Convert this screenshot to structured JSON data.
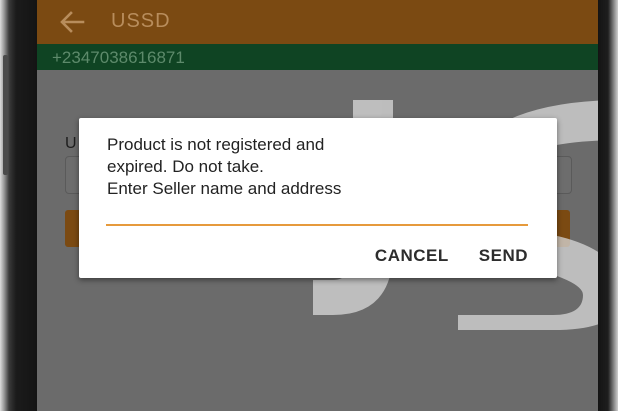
{
  "appbar": {
    "title": "USSD",
    "back_icon": "arrow-left-icon",
    "color": "#7b4a12"
  },
  "subbar": {
    "phone_number": "+2347038616871",
    "color": "#0f4423"
  },
  "background_form": {
    "label": "U"
  },
  "dialog": {
    "message_line1": "Product is not registered and",
    "message_line2": "expired. Do not take.",
    "message_line3": "Enter Seller name and address",
    "input_value": "",
    "accent_color": "#e69a3c",
    "cancel_label": "CANCEL",
    "send_label": "SEND"
  },
  "watermark": {
    "text": "JS"
  }
}
